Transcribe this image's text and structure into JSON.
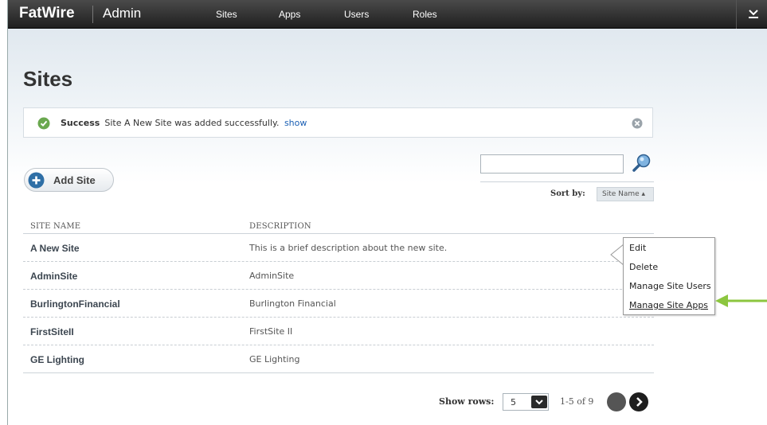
{
  "header": {
    "brand": "FatWire",
    "app_name": "Admin",
    "nav": [
      {
        "label": "Sites"
      },
      {
        "label": "Apps"
      },
      {
        "label": "Users"
      },
      {
        "label": "Roles"
      }
    ],
    "user_menu_icon": "chevron-down-icon"
  },
  "page": {
    "title": "Sites"
  },
  "notification": {
    "title": "Success",
    "message": "Site A New Site was added successfully.",
    "link": "show",
    "icon": "check-circle-icon",
    "close_icon": "close-icon",
    "accent_color": "#6aa84f"
  },
  "toolbar": {
    "add_label": "Add Site",
    "search_value": "",
    "sort_label": "Sort by:",
    "sort_value": "Site Name ▴"
  },
  "table": {
    "columns": [
      "SITE NAME",
      "DESCRIPTION"
    ],
    "rows": [
      {
        "name": "A New Site",
        "description": "This is a brief description about the new site."
      },
      {
        "name": "AdminSite",
        "description": "AdminSite"
      },
      {
        "name": "BurlingtonFinancial",
        "description": "Burlington Financial"
      },
      {
        "name": "FirstSiteII",
        "description": "FirstSite II"
      },
      {
        "name": "GE Lighting",
        "description": "GE Lighting"
      }
    ]
  },
  "context_menu": {
    "items": [
      {
        "label": "Edit"
      },
      {
        "label": "Delete"
      },
      {
        "label": "Manage Site Users"
      },
      {
        "label": "Manage Site Apps"
      }
    ],
    "active_index": 3
  },
  "annotation": {
    "arrow_color": "#8cc63f"
  },
  "pager": {
    "show_rows_label": "Show rows:",
    "rows_value": "5",
    "range": "1-5 of 9"
  }
}
